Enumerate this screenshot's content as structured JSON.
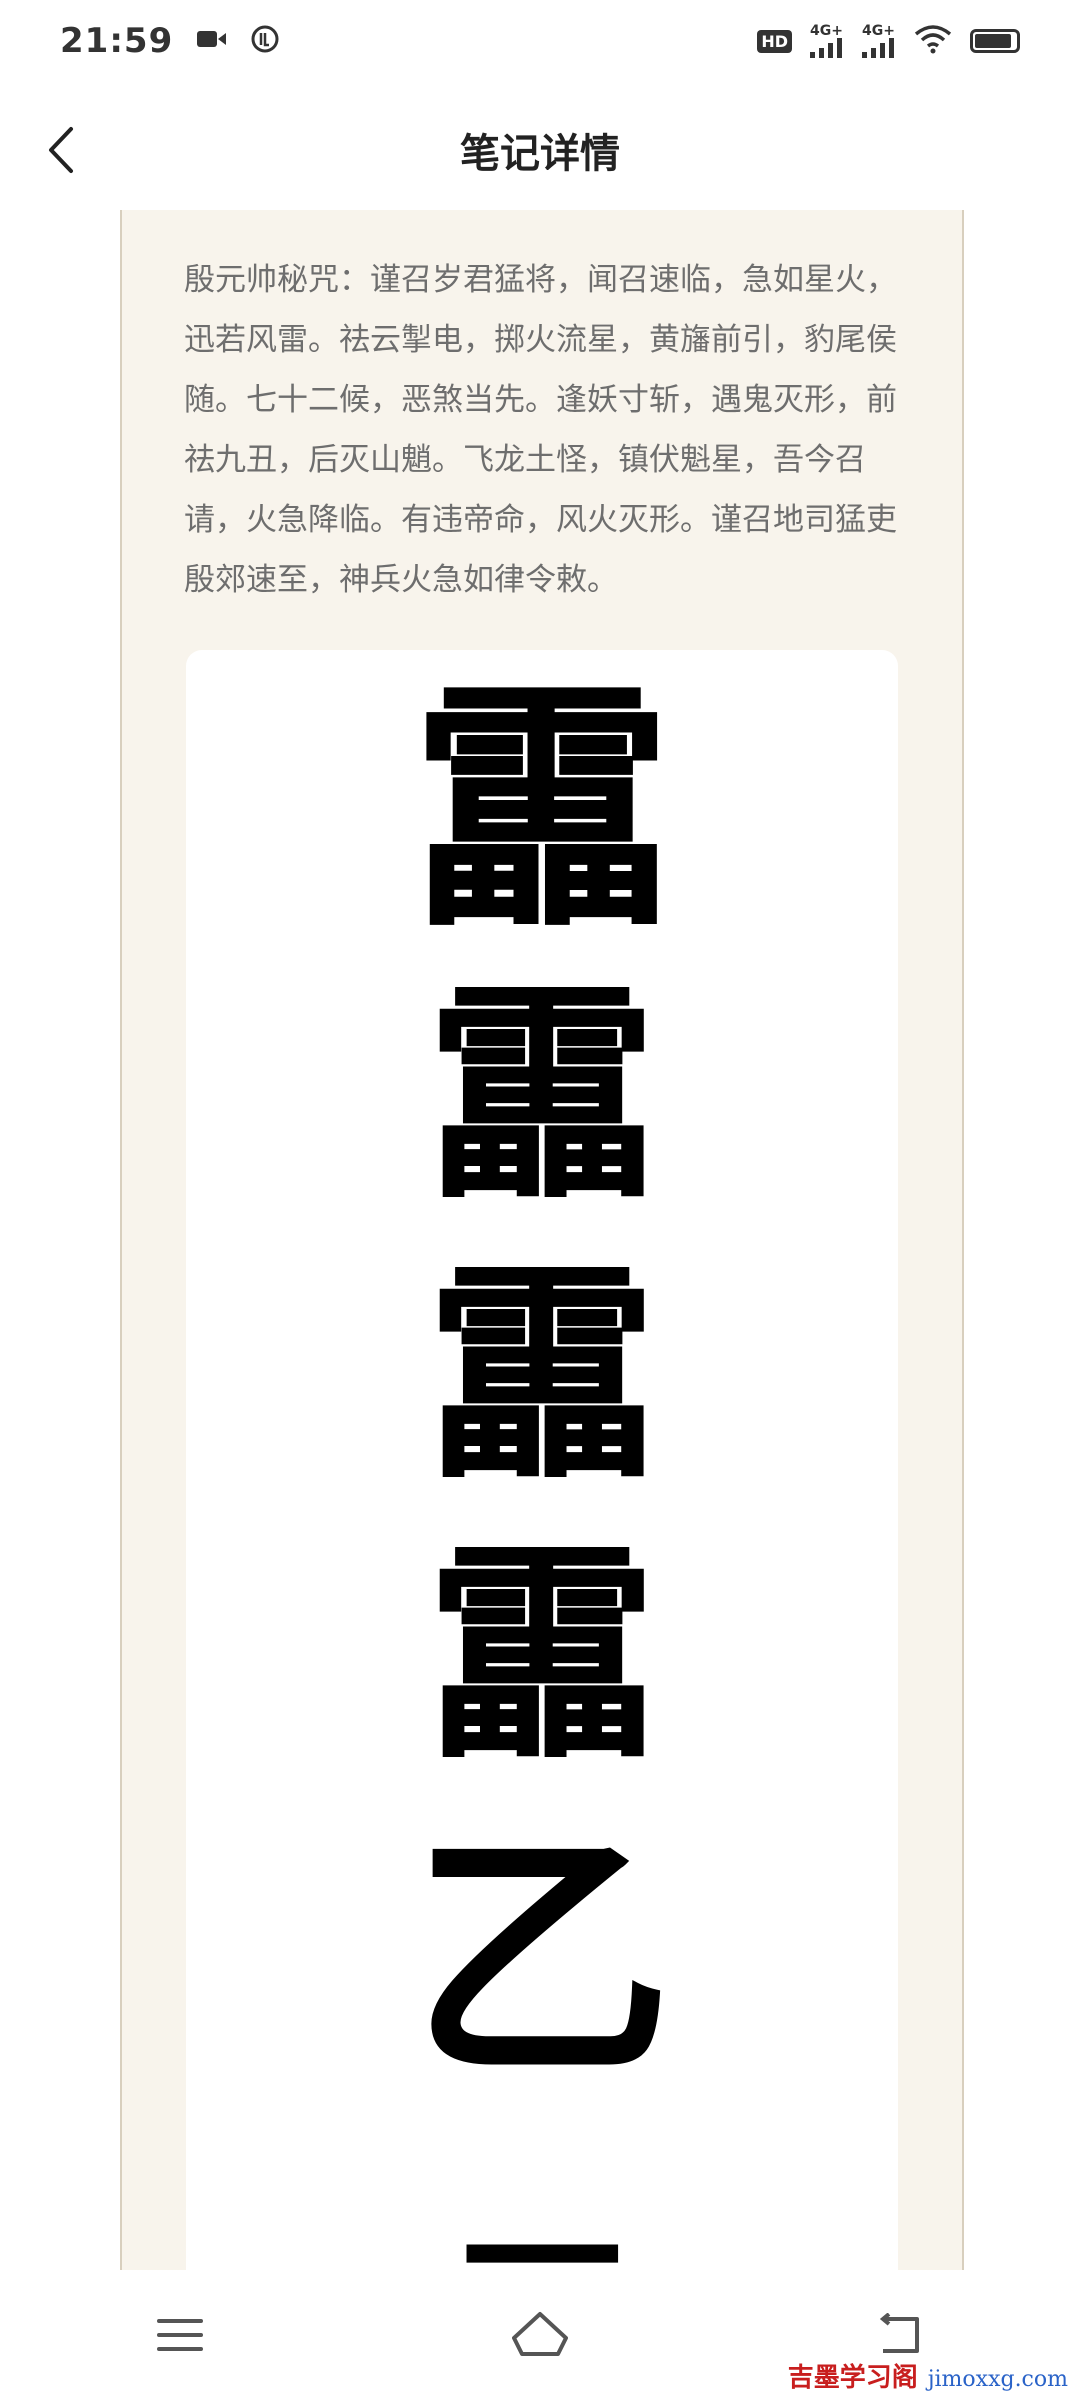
{
  "status_bar": {
    "time": "21:59",
    "icons": [
      "video-icon",
      "nfc-icon",
      "hd-icon",
      "signal-4g-icon",
      "signal-4g-icon",
      "wifi-icon",
      "battery-icon"
    ],
    "hd_label": "HD",
    "sim1_label": "4G+",
    "sim2_label": "4G+",
    "battery_level": 0.85
  },
  "header": {
    "title": "笔记详情",
    "back_icon": "chevron-left-icon"
  },
  "note": {
    "text": "殷元帅秘咒：谨召岁君猛将，闻召速临，急如星火，迅若风雷。祛云掣电，掷火流星，黄旛前引，豹尾侯随。七十二候，恶煞当先。逢妖寸斩，遇鬼灭形，前祛九丑，后灭山魈。飞龙土怪，镇伏魁星，吾今召请，火急降临。有违帝命，风火灭形。谨召地司猛吏殷郊速至，神兵火急如律令敕。",
    "talisman_glyphs": [
      "靁",
      "靁",
      "靁",
      "靁",
      "乙",
      "一"
    ]
  },
  "nav_bar": {
    "icons": [
      "menu-icon",
      "home-icon",
      "back-icon"
    ]
  },
  "watermark": {
    "cn": "吉墨学习阁",
    "en": "jimoxxg.com"
  }
}
